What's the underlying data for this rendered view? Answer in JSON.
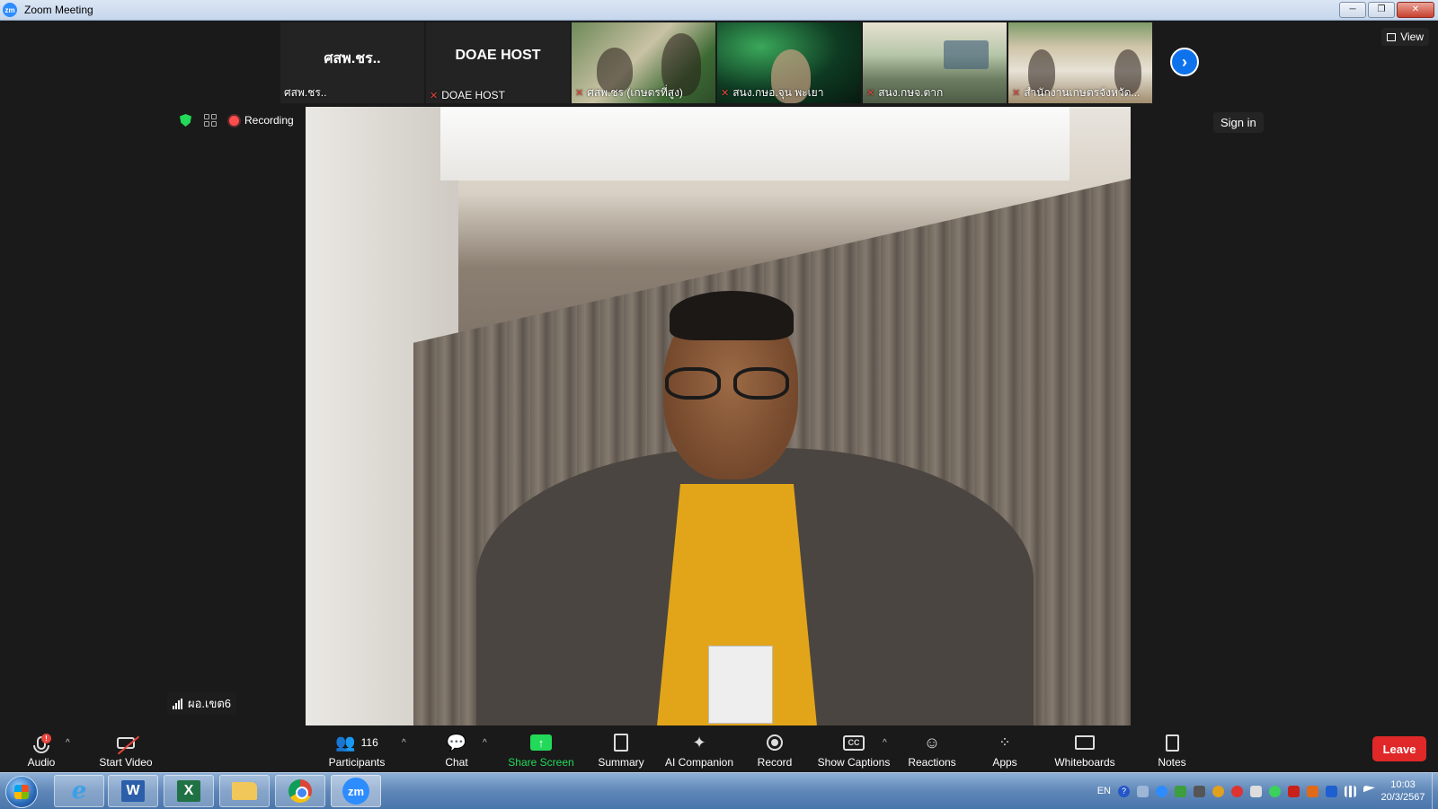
{
  "window": {
    "title": "Zoom Meeting",
    "app_badge": "zm",
    "minimize": "─",
    "restore": "❐",
    "close": "✕"
  },
  "gallery": {
    "tiles": [
      {
        "big_name": "ศสพ.ชร..",
        "name": "ศสพ.ชร..",
        "muted": false
      },
      {
        "big_name": "DOAE HOST",
        "name": "DOAE HOST",
        "muted": true
      },
      {
        "name": "ศสพ.ชร (เกษตรที่สูง)",
        "muted": true
      },
      {
        "name": "สนง.กษอ.จุน พะเยา",
        "muted": true
      },
      {
        "name": "สนง.กษจ.ตาก",
        "muted": true
      },
      {
        "name": "สำนักงานเกษตรจังหวัด...",
        "muted": true
      }
    ],
    "next_glyph": "›"
  },
  "top_right": {
    "view_label": "View",
    "sign_in_label": "Sign in"
  },
  "status": {
    "recording_label": "Recording"
  },
  "speaker": {
    "name": "ผอ.เขต6"
  },
  "toolbar": {
    "audio_label": "Audio",
    "audio_alert": "!",
    "caret": "^",
    "start_video_label": "Start Video",
    "participants_label": "Participants",
    "participants_count": "116",
    "chat_label": "Chat",
    "share_screen_label": "Share Screen",
    "summary_label": "Summary",
    "ai_companion_label": "AI Companion",
    "record_label": "Record",
    "show_captions_label": "Show Captions",
    "cc_text": "CC",
    "reactions_label": "Reactions",
    "apps_label": "Apps",
    "whiteboards_label": "Whiteboards",
    "notes_label": "Notes",
    "leave_label": "Leave",
    "share_color": "#23d959",
    "leave_color": "#e02828"
  },
  "taskbar": {
    "word_letter": "W",
    "excel_letter": "X",
    "ie_letter": "e",
    "zoom_label": "zm",
    "lang": "EN",
    "help": "?",
    "time": "10:03",
    "date": "20/3/2567"
  }
}
